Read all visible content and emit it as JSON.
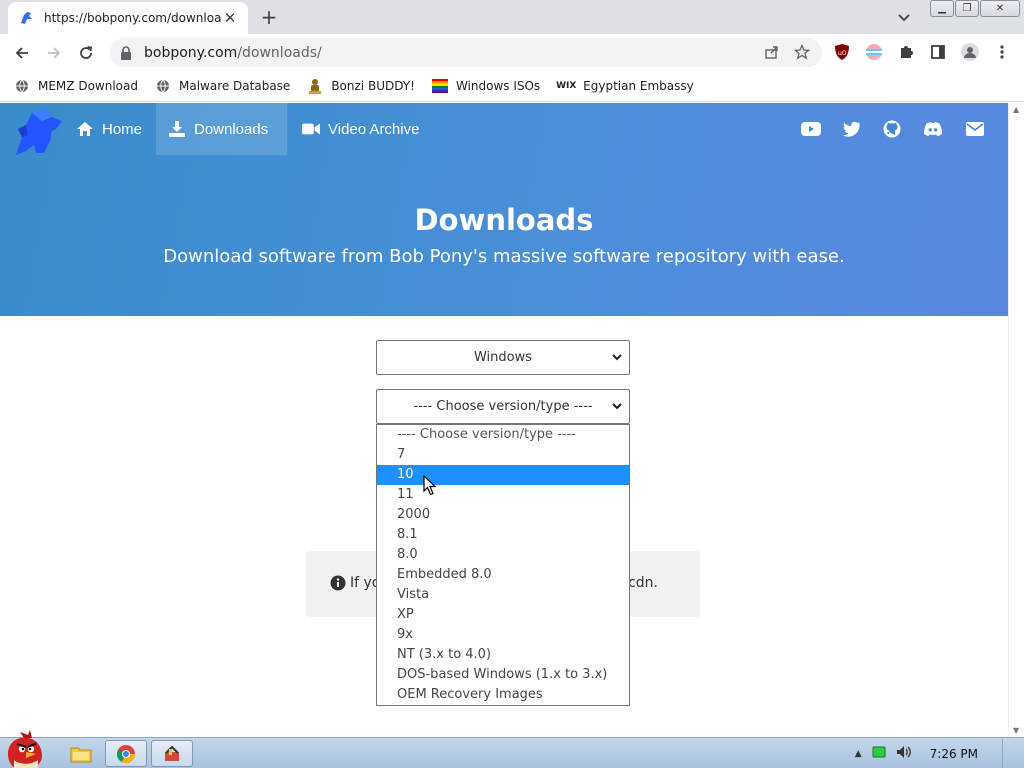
{
  "browser": {
    "tab_title": "https://bobpony.com/downloads",
    "url_host": "bobpony.com",
    "url_path": "/downloads/",
    "bookmarks": [
      {
        "label": "MEMZ Download"
      },
      {
        "label": "Malware Database"
      },
      {
        "label": "Bonzi BUDDY!"
      },
      {
        "label": "Windows ISOs"
      },
      {
        "label": "Egyptian Embassy"
      }
    ]
  },
  "site": {
    "nav": {
      "home": "Home",
      "downloads": "Downloads",
      "videos": "Video Archive"
    },
    "hero": {
      "title": "Downloads",
      "subtitle": "Download software from Bob Pony's massive software repository with ease."
    },
    "os_select": {
      "value": "Windows"
    },
    "version_select": {
      "value": "---- Choose version/type ----"
    },
    "dropdown_options": [
      "---- Choose version/type ----",
      "7",
      "10",
      "11",
      "2000",
      "8.1",
      "8.0",
      "Embedded 8.0",
      "Vista",
      "XP",
      "9x",
      "NT (3.x to 4.0)",
      "DOS-based Windows (1.x to 3.x)",
      "OEM Recovery Images"
    ],
    "selected_option": "10",
    "notice": {
      "text_start": "If yo",
      "text_end": "cdn."
    },
    "colors": {
      "hero_start": "#3a8ccc",
      "hero_end": "#5a88e0",
      "selected": "#1e90ff"
    }
  },
  "taskbar": {
    "clock": "7:26 PM"
  }
}
